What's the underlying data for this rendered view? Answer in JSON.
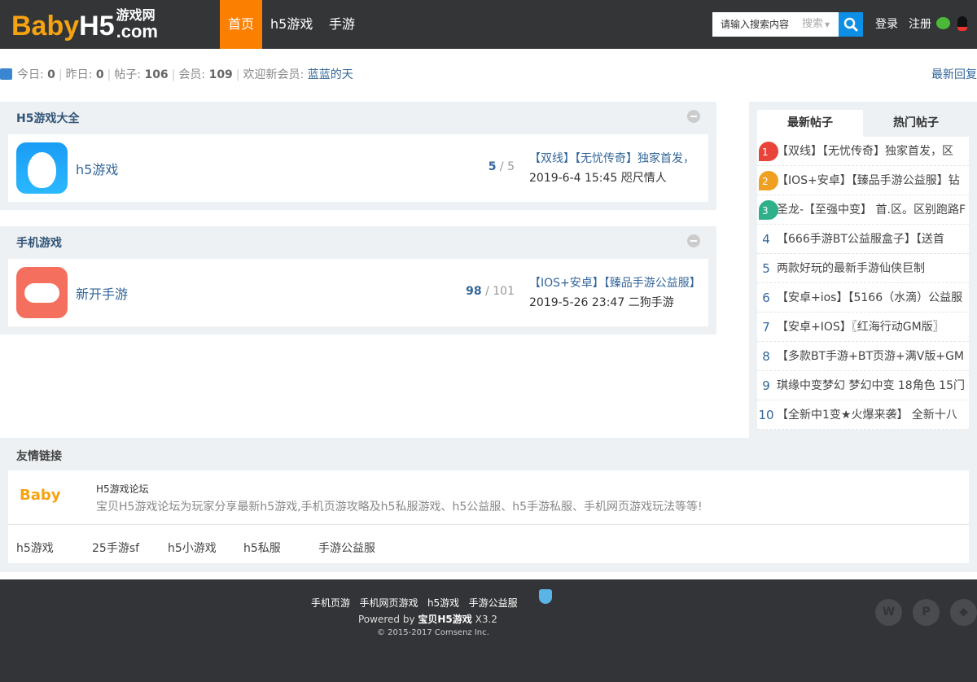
{
  "header": {
    "logo_text": "BabyH5游戏网.com",
    "logo_baby": "Baby",
    "logo_h5": "H5",
    "logo_cn": "游戏网",
    "logo_com": ".com",
    "nav": [
      {
        "label": "首页",
        "active": true
      },
      {
        "label": "h5游戏"
      },
      {
        "label": "手游"
      }
    ],
    "search_placeholder": "请输入搜索内容",
    "search_type": "搜索",
    "login": "登录",
    "register": "注册"
  },
  "stats": {
    "today_label": "今日:",
    "today": "0",
    "yesterday_label": "昨日:",
    "yesterday": "0",
    "posts_label": "帖子:",
    "posts": "106",
    "members_label": "会员:",
    "members": "109",
    "newest_label": "欢迎新会员:",
    "newest": "蓝蓝的天",
    "latest_replies": "最新回复"
  },
  "sections": [
    {
      "title": "H5游戏大全",
      "forum": {
        "name": "h5游戏",
        "threads": "5",
        "posts": "5",
        "last_title": "【双线】【无忧传奇】独家首发，",
        "last_time": "2019-6-4 15:45",
        "last_user": "咫尺情人"
      }
    },
    {
      "title": "手机游戏",
      "forum": {
        "name": "新开手游",
        "threads": "98",
        "posts": "101",
        "last_title": "【IOS+安卓】【臻品手游公益服】",
        "last_time": "2019-5-26 23:47",
        "last_user": "二狗手游"
      }
    }
  ],
  "sidebar": {
    "tabs": [
      "最新帖子",
      "热门帖子"
    ],
    "items": [
      {
        "n": "1",
        "t": "【双线】【无忧传奇】独家首发，区"
      },
      {
        "n": "2",
        "t": "【IOS+安卓】【臻品手游公益服】钻"
      },
      {
        "n": "3",
        "t": "圣龙-【至强中变】 首.区。区别跑路F"
      },
      {
        "n": "4",
        "t": "【666手游BT公益服盒子】【送首"
      },
      {
        "n": "5",
        "t": "两款好玩的最新手游仙侠巨制"
      },
      {
        "n": "6",
        "t": "【安卓+ios】【5166（水滴）公益服"
      },
      {
        "n": "7",
        "t": "【安卓+IOS】〖红海行动GM版〗"
      },
      {
        "n": "8",
        "t": "【多款BT手游+BT页游+满V版+GM"
      },
      {
        "n": "9",
        "t": "琪缘中变梦幻 梦幻中变 18角色 15门"
      },
      {
        "n": "10",
        "t": "【全新中1变★火爆来袭】 全新十八"
      }
    ],
    "fire_colors": [
      "#e8443a",
      "#f0a020",
      "#2fb08a"
    ]
  },
  "friends": {
    "title": "友情链接",
    "logo": "Baby",
    "site_name": "H5游戏论坛",
    "site_desc": "宝贝H5游戏论坛为玩家分享最新h5游戏,手机页游攻略及h5私服游戏、h5公益服、h5手游私服、手机网页游戏玩法等等!",
    "links": [
      "h5游戏",
      "25手游sf",
      "h5小游戏",
      "h5私服",
      "手游公益服"
    ]
  },
  "footer": {
    "links": [
      "手机页游",
      "手机网页游戏",
      "h5游戏",
      "手游公益服"
    ],
    "powered_prefix": "Powered by",
    "powered_brand": "宝贝H5游戏",
    "version": "X3.2",
    "copyright": "© 2015-2017 Comsenz Inc."
  }
}
